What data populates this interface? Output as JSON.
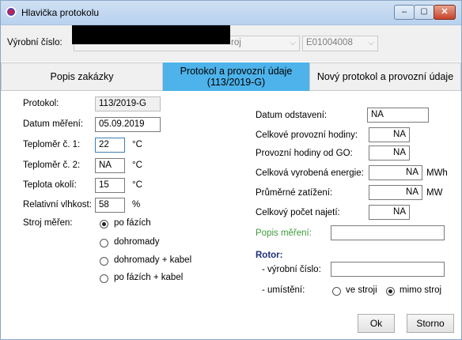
{
  "window": {
    "title": "Hlavička protokolu",
    "controls": {
      "minimize": "‒",
      "maximize": "▢",
      "close": "✕"
    }
  },
  "top": {
    "serial_label": "Výrobní číslo:",
    "combo1_text": "roj",
    "combo2_text": "E01004008"
  },
  "tabs": [
    {
      "label": "Popis zakázky"
    },
    {
      "label": "Protokol a provozní údaje\n(113/2019-G)"
    },
    {
      "label": "Nový protokol a provozní údaje"
    }
  ],
  "left": {
    "protokol_label": "Protokol:",
    "protokol_value": "113/2019-G",
    "datum_label": "Datum měření:",
    "datum_value": "05.09.2019",
    "teplomer1_label": "Teploměr č. 1:",
    "teplomer1_value": "22",
    "teplomer1_unit": "°C",
    "teplomer2_label": "Teploměr č. 2:",
    "teplomer2_value": "NA",
    "teplomer2_unit": "°C",
    "okoli_label": "Teplota okolí:",
    "okoli_value": "15",
    "okoli_unit": "°C",
    "vlhkost_label": "Relativní vlhkost:",
    "vlhkost_value": "58",
    "vlhkost_unit": "%",
    "stroj_label": "Stroj měřen:",
    "stroj_options": [
      "po fázích",
      "dohromady",
      "dohromady + kabel",
      "po fázích + kabel"
    ],
    "stroj_selected": 0
  },
  "right": {
    "odstaveni_label": "Datum odstavení:",
    "odstaveni_value": "NA",
    "celkove_hodiny_label": "Celkové provozní hodiny:",
    "celkove_hodiny_value": "NA",
    "hodiny_go_label": "Provozní hodiny od GO:",
    "hodiny_go_value": "NA",
    "energie_label": "Celková vyrobená energie:",
    "energie_value": "NA",
    "energie_unit": "MWh",
    "zatizeni_label": "Průměrné zatížení:",
    "zatizeni_value": "NA",
    "zatizeni_unit": "MW",
    "najeti_label": "Celkový počet najetí:",
    "najeti_value": "NA",
    "popis_label": "Popis měření:",
    "popis_value": "",
    "rotor_label": "Rotor:",
    "rotor_serial_label": "- výrobní číslo:",
    "rotor_serial_value": "",
    "umisteni_label": "- umístění:",
    "umisteni_options": [
      "ve stroji",
      "mimo stroj"
    ],
    "umisteni_selected": 1
  },
  "buttons": {
    "ok": "Ok",
    "storno": "Storno"
  },
  "colors": {
    "active_tab": "#4db3ea",
    "green_label": "#3f9a3f",
    "rotor_label": "#1f2f7a"
  }
}
